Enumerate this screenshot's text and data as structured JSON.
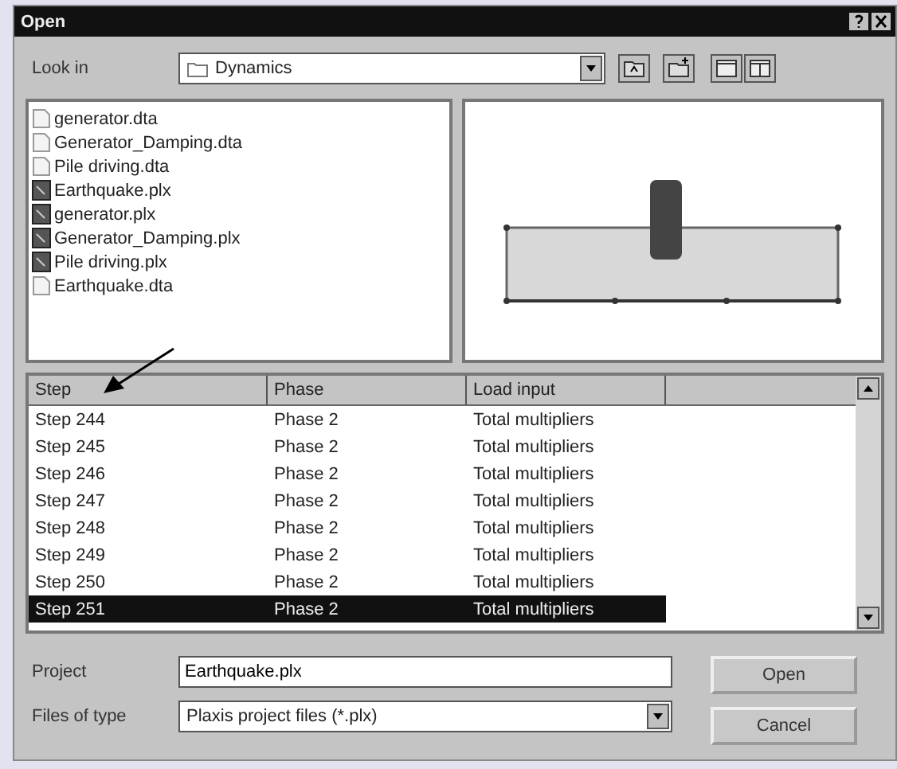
{
  "window": {
    "title": "Open"
  },
  "look_in": {
    "label": "Look in",
    "value": "Dynamics"
  },
  "files": [
    {
      "name": "generator.dta",
      "kind": "dta"
    },
    {
      "name": "Generator_Damping.dta",
      "kind": "dta"
    },
    {
      "name": "Pile driving.dta",
      "kind": "dta"
    },
    {
      "name": "Earthquake.plx",
      "kind": "plx"
    },
    {
      "name": "generator.plx",
      "kind": "plx"
    },
    {
      "name": "Generator_Damping.plx",
      "kind": "plx"
    },
    {
      "name": "Pile driving.plx",
      "kind": "plx"
    },
    {
      "name": "Earthquake.dta",
      "kind": "dta"
    }
  ],
  "table": {
    "columns": [
      "Step",
      "Phase",
      "Load input"
    ],
    "rows": [
      {
        "cells": [
          "Step 244",
          "Phase 2",
          "Total multipliers"
        ],
        "selected": false
      },
      {
        "cells": [
          "Step 245",
          "Phase 2",
          "Total multipliers"
        ],
        "selected": false
      },
      {
        "cells": [
          "Step 246",
          "Phase 2",
          "Total multipliers"
        ],
        "selected": false
      },
      {
        "cells": [
          "Step 247",
          "Phase 2",
          "Total multipliers"
        ],
        "selected": false
      },
      {
        "cells": [
          "Step 248",
          "Phase 2",
          "Total multipliers"
        ],
        "selected": false
      },
      {
        "cells": [
          "Step 249",
          "Phase 2",
          "Total multipliers"
        ],
        "selected": false
      },
      {
        "cells": [
          "Step 250",
          "Phase 2",
          "Total multipliers"
        ],
        "selected": false
      },
      {
        "cells": [
          "Step 251",
          "Phase 2",
          "Total multipliers"
        ],
        "selected": true
      }
    ]
  },
  "project": {
    "label": "Project",
    "value": "Earthquake.plx"
  },
  "file_type": {
    "label": "Files of type",
    "value": "Plaxis project files (*.plx)"
  },
  "buttons": [
    "Open",
    "Cancel"
  ]
}
